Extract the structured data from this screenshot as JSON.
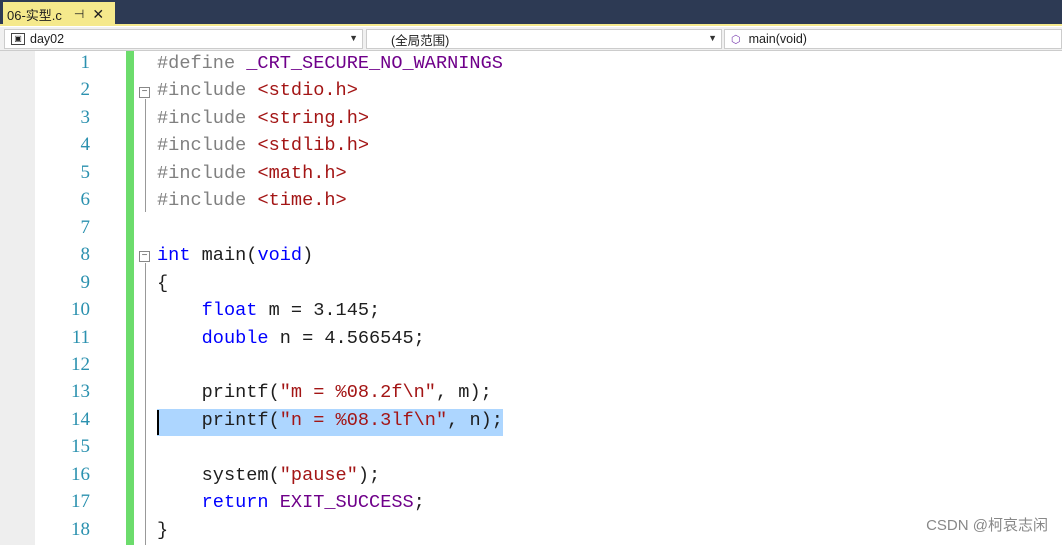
{
  "tab": {
    "title": "06-实型.c",
    "pin_icon": "pin-icon",
    "close_icon": "close-icon"
  },
  "nav": {
    "project": "day02",
    "scope": "(全局范围)",
    "function": "main(void)"
  },
  "colors": {
    "keyword": "#0000ff",
    "string": "#a31515",
    "preprocessor": "#808080",
    "macro": "#6f008a",
    "line_number": "#2b91af",
    "selection": "#add6ff",
    "changed_bar": "#6cdc6c"
  },
  "lines": [
    [
      [
        "#define ",
        "pp"
      ],
      [
        "_CRT_SECURE_NO_WARNINGS",
        "mac"
      ]
    ],
    [
      [
        "#include ",
        "pp"
      ],
      [
        "<stdio.h>",
        "str"
      ]
    ],
    [
      [
        "#include ",
        "pp"
      ],
      [
        "<string.h>",
        "str"
      ]
    ],
    [
      [
        "#include ",
        "pp"
      ],
      [
        "<stdlib.h>",
        "str"
      ]
    ],
    [
      [
        "#include ",
        "pp"
      ],
      [
        "<math.h>",
        "str"
      ]
    ],
    [
      [
        "#include ",
        "pp"
      ],
      [
        "<time.h>",
        "str"
      ]
    ],
    [],
    [
      [
        "int",
        "kw"
      ],
      [
        " main(",
        ""
      ],
      [
        "void",
        "kw"
      ],
      [
        ")",
        ""
      ]
    ],
    [
      [
        "{",
        ""
      ]
    ],
    [
      [
        "    ",
        ""
      ],
      [
        "float",
        "kw"
      ],
      [
        " m = 3.145;",
        ""
      ]
    ],
    [
      [
        "    ",
        ""
      ],
      [
        "double",
        "kw"
      ],
      [
        " n = 4.566545;",
        ""
      ]
    ],
    [],
    [
      [
        "    printf(",
        ""
      ],
      [
        "\"m = %08.2f\\n\"",
        "str"
      ],
      [
        ", m);",
        ""
      ]
    ],
    [
      [
        "    printf(",
        ""
      ],
      [
        "\"n = %08.3lf\\n\"",
        "str"
      ],
      [
        ", n);",
        ""
      ]
    ],
    [],
    [
      [
        "    system(",
        ""
      ],
      [
        "\"pause\"",
        "str"
      ],
      [
        ");",
        ""
      ]
    ],
    [
      [
        "    ",
        ""
      ],
      [
        "return",
        "kw"
      ],
      [
        " ",
        ""
      ],
      [
        "EXIT_SUCCESS",
        "mac"
      ],
      [
        ";",
        ""
      ]
    ],
    [
      [
        "}",
        ""
      ]
    ]
  ],
  "watermark": "CSDN @柯哀志闲"
}
